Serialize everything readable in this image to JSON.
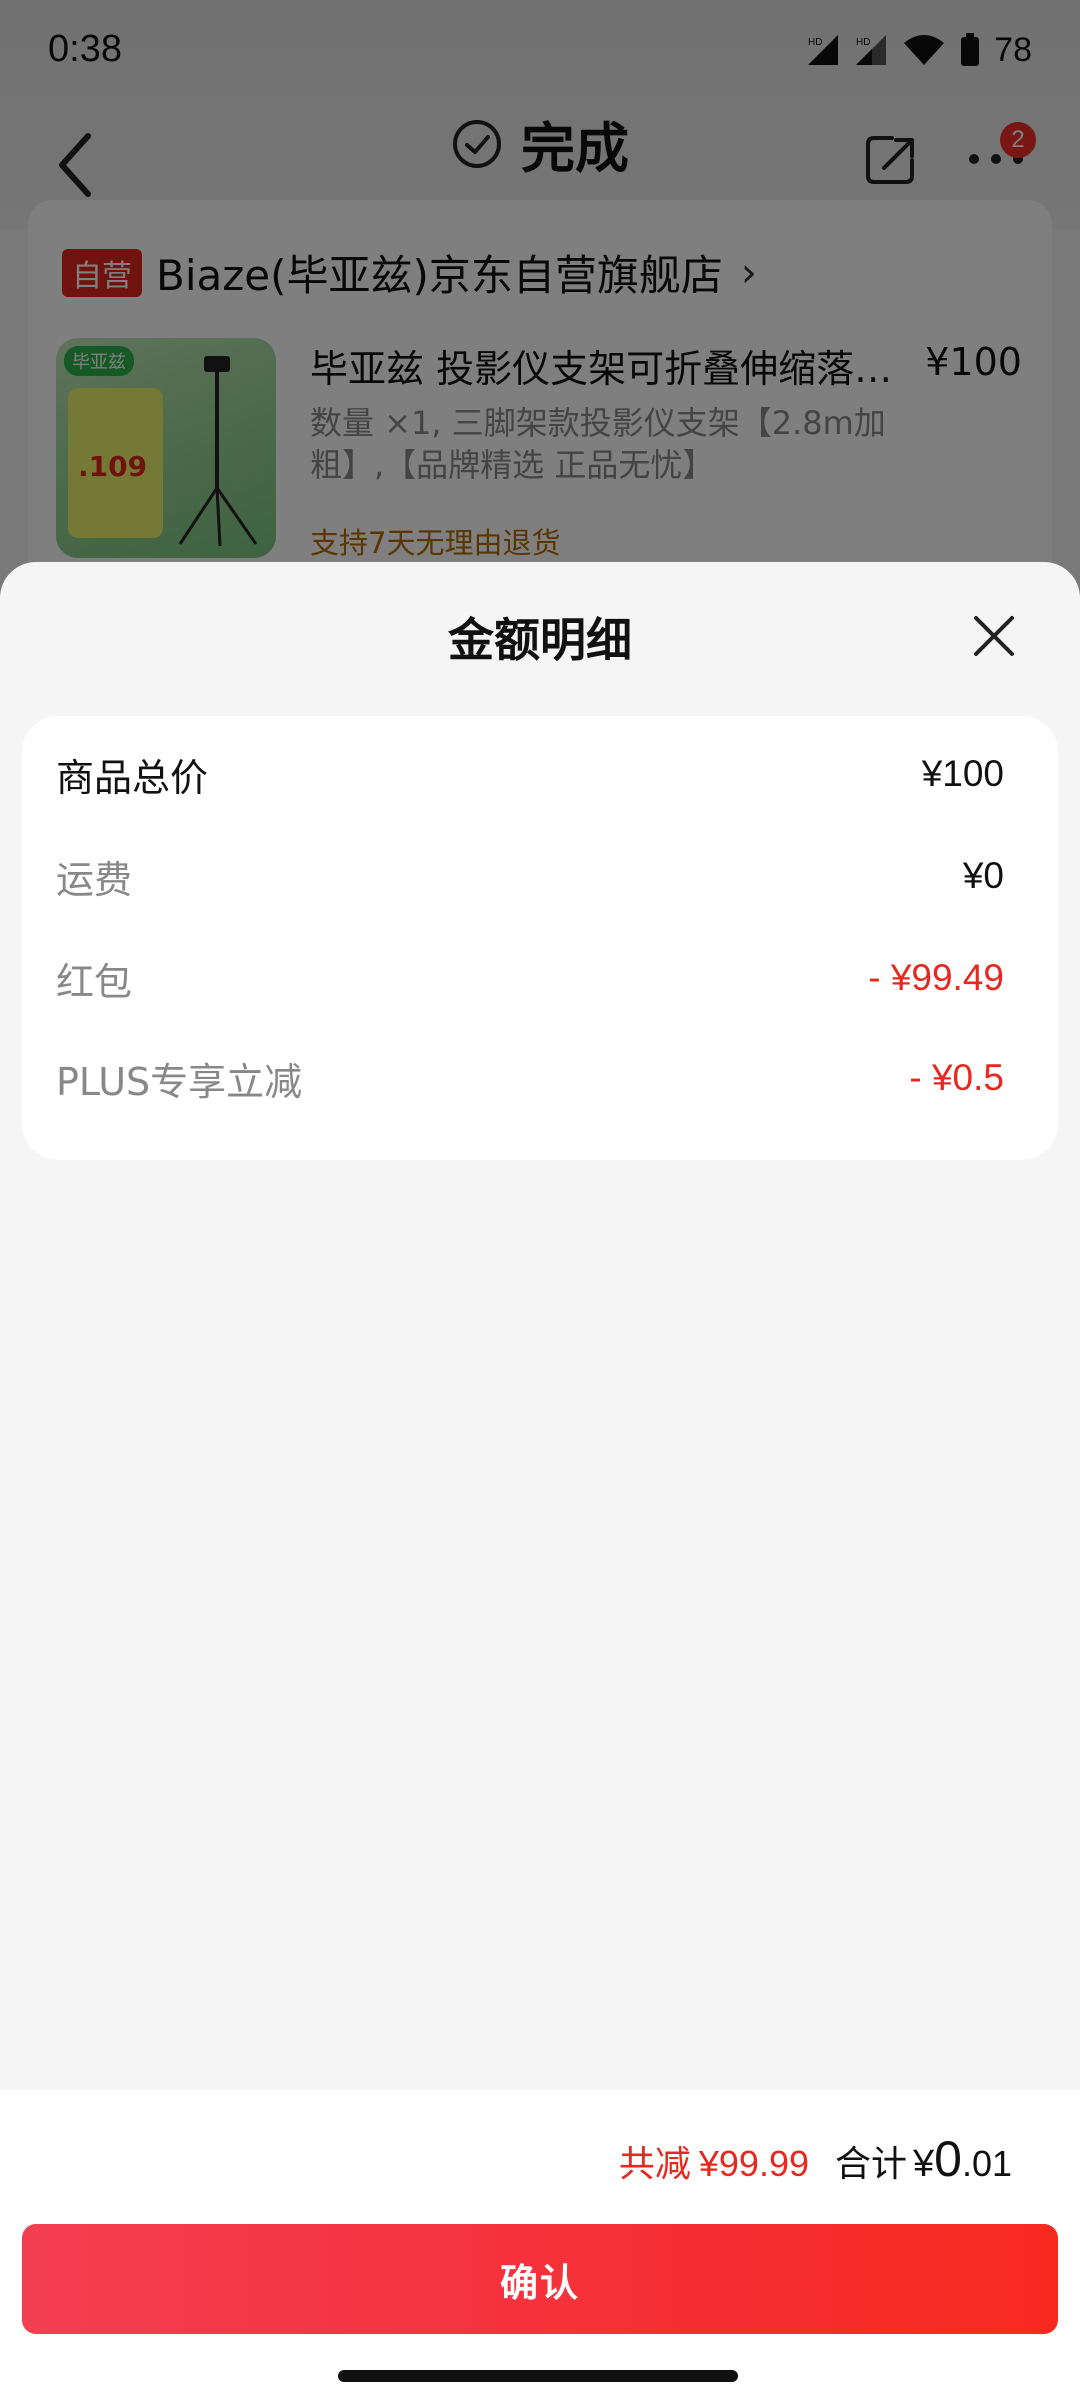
{
  "status_bar": {
    "time": "0:38",
    "battery": "78"
  },
  "header": {
    "title": "完成",
    "menu_badge": "2"
  },
  "store": {
    "tag": "自营",
    "name": "Biaze(毕亚兹)京东自营旗舰店",
    "chevron": "›"
  },
  "product": {
    "title": "毕亚兹 投影仪支架可折叠伸缩落…",
    "price": "¥100",
    "spec": "数量 ×1, 三脚架款投影仪支架【2.8m加粗】,【品牌精选 正品无忧】",
    "return_policy": "支持7天无理由退货",
    "thumb_logo": "毕亚兹",
    "thumb_price": ".109"
  },
  "sheet": {
    "title": "金额明细",
    "rows": [
      {
        "label": "商品总价",
        "value": "¥100",
        "style": "total"
      },
      {
        "label": "运费",
        "value": "¥0",
        "style": "normal"
      },
      {
        "label": "红包",
        "value": "- ¥99.49",
        "style": "discount"
      },
      {
        "label": "PLUS专享立减",
        "value": "- ¥0.5",
        "style": "discount"
      }
    ]
  },
  "footer": {
    "save_label": "共减",
    "save_amount": "¥99.99",
    "total_label": "合计",
    "total_yen": "¥",
    "total_int": "0",
    "total_dec": ".01"
  },
  "confirm": {
    "label": "确认"
  },
  "colors": {
    "accent_red": "#e6281e",
    "button_gradient_start": "#f43e52",
    "button_gradient_end": "#f82a1f"
  }
}
